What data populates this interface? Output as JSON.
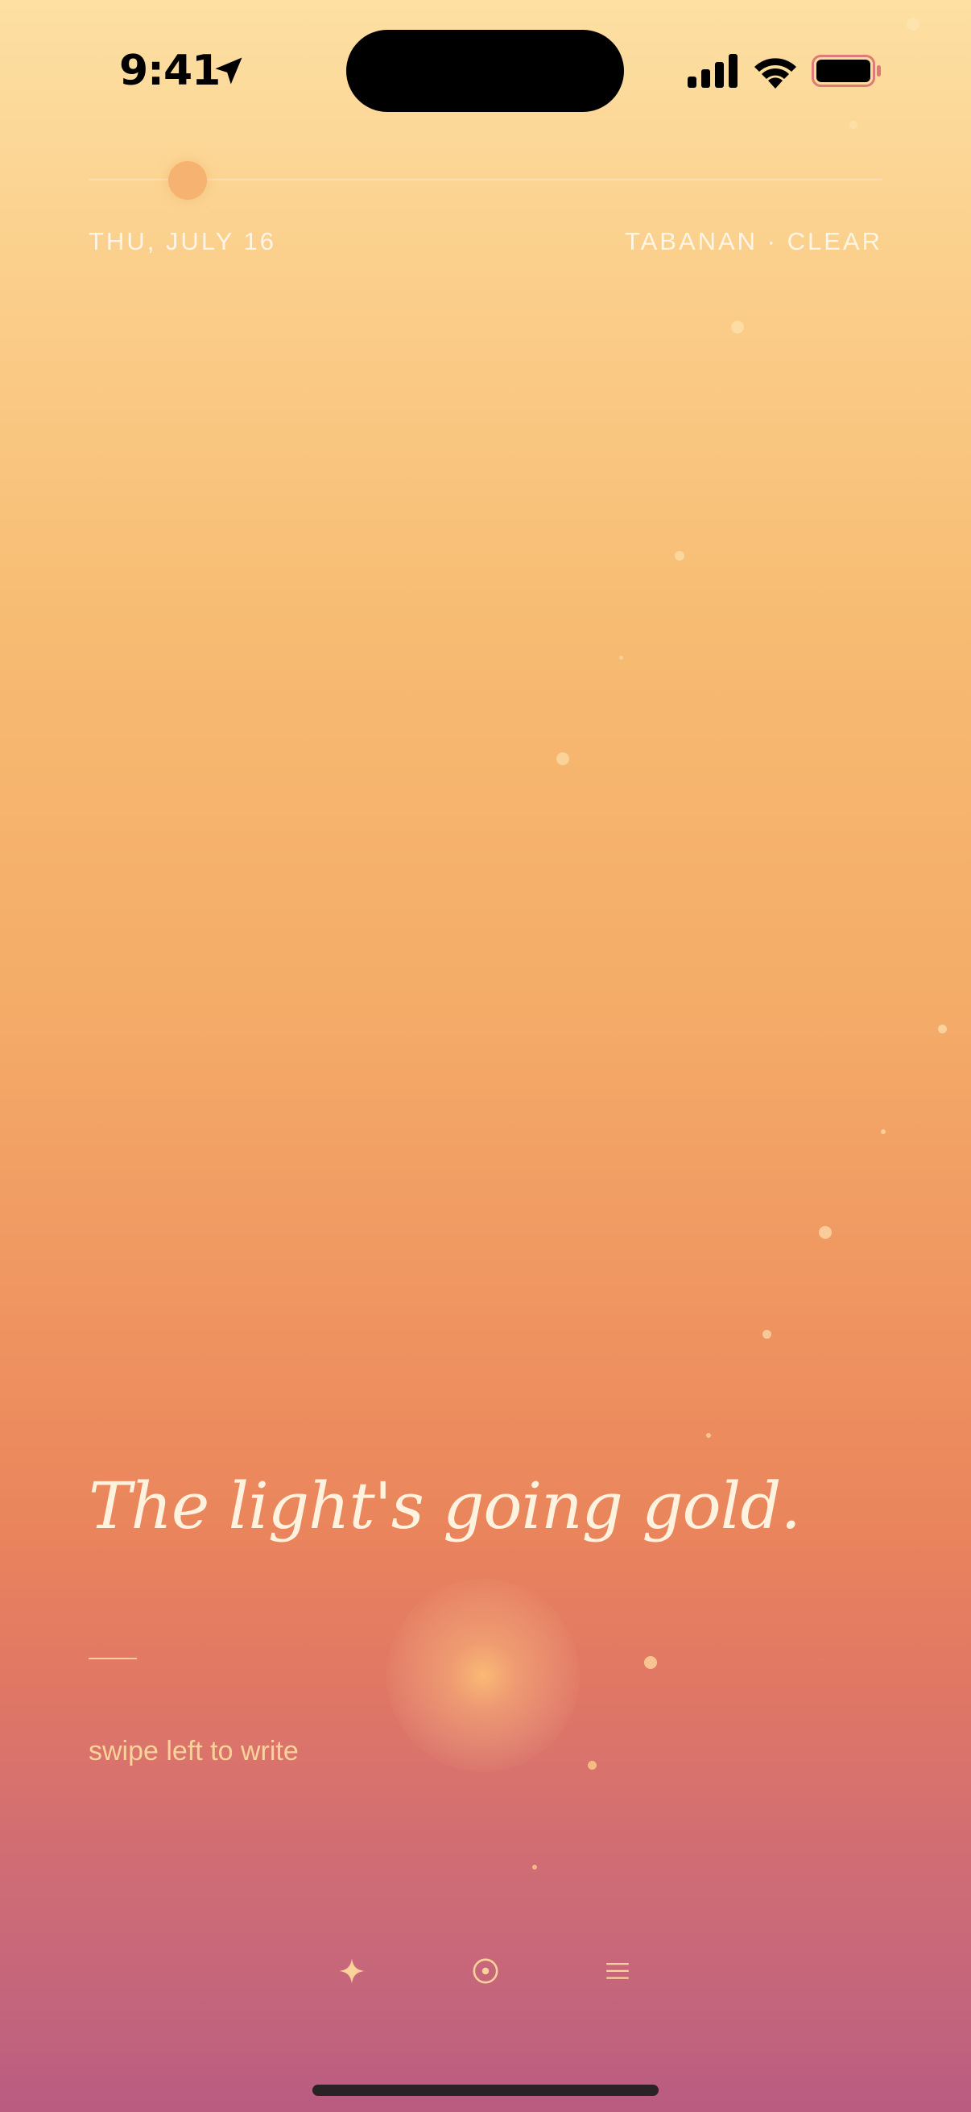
{
  "status_bar": {
    "time": "9:41"
  },
  "header": {
    "date": "THU, JULY 16",
    "location_weather": "TABANAN · CLEAR"
  },
  "main": {
    "headline": "The light's going gold.",
    "hint": "swipe left to write"
  },
  "nav": {
    "items": [
      {
        "icon": "sparkle-icon"
      },
      {
        "icon": "target-icon"
      },
      {
        "icon": "menu-icon"
      }
    ]
  },
  "colors": {
    "gradient_top": "#fde0a3",
    "gradient_mid": "#ef9561",
    "gradient_bottom": "#b95b80",
    "accent": "#fbd39a",
    "sun": "#f5b271"
  }
}
